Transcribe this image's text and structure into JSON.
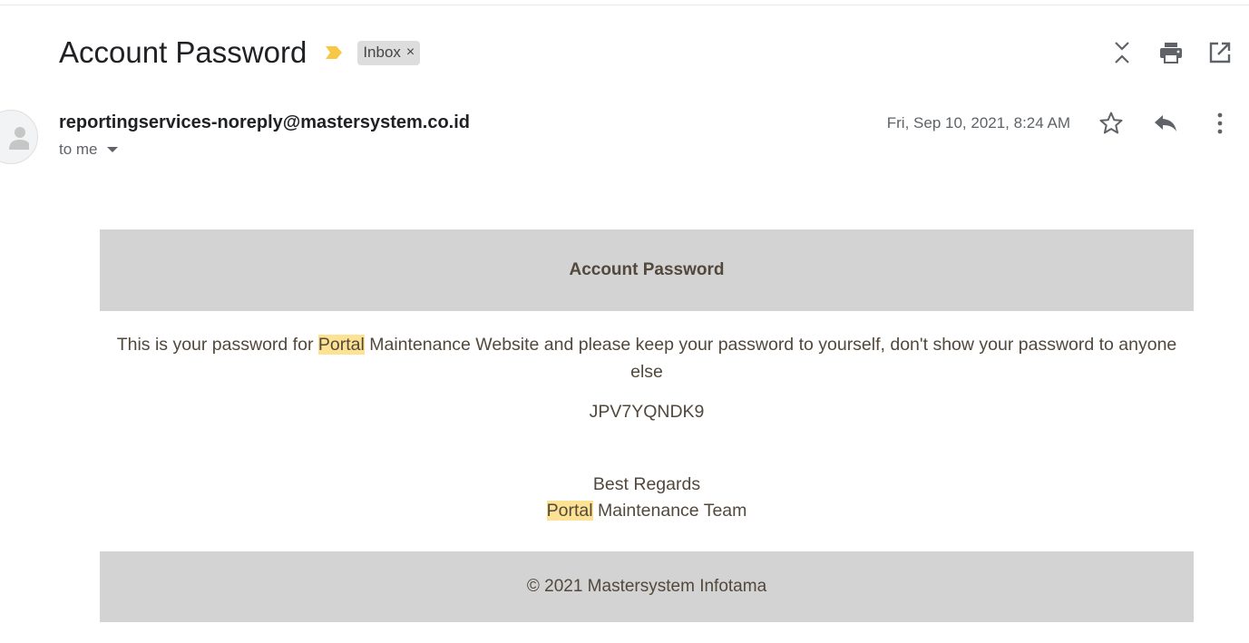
{
  "email": {
    "subject": "Account Password",
    "label_chip": "Inbox",
    "label_remove_glyph": "×",
    "sender": "reportingservices-noreply@mastersystem.co.id",
    "recipient_text": "to me",
    "date": "Fri, Sep 10, 2021, 8:24 AM"
  },
  "icons": {
    "importance": "importance-marker-icon",
    "collapse": "collapse-all-icon",
    "print": "print-icon",
    "new_window": "open-in-new-window-icon",
    "star": "star-icon",
    "reply": "reply-icon",
    "more": "more-vert-icon",
    "avatar": "default-avatar-icon"
  },
  "body": {
    "header_title": "Account Password",
    "para_prefix": "This is your password for ",
    "para_highlight": "Portal",
    "para_suffix": " Maintenance Website and please keep your password to yourself, don't show your password to anyone else",
    "password_code": "JPV7YQNDK9",
    "regards_line": "Best Regards",
    "team_highlight": "Portal",
    "team_suffix": " Maintenance Team",
    "footer_text": "© 2021 Mastersystem Infotama"
  },
  "colors": {
    "highlight": "#fde293",
    "panel_bg": "#d3d3d3",
    "body_text": "#52483c",
    "importance": "#f6c845"
  }
}
